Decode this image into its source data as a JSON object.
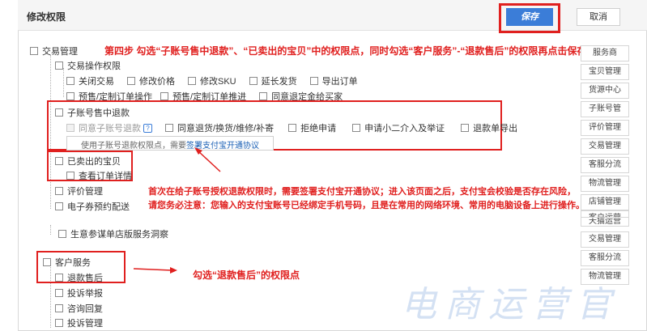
{
  "header": {
    "title": "修改权限",
    "save_label": "保存",
    "cancel_label": "取消"
  },
  "tree": {
    "trade": "交易管理",
    "trade_ops": "交易操作权限",
    "trade_ops_items": [
      "关闭交易",
      "修改价格",
      "修改SKU",
      "延长发货",
      "导出订单"
    ],
    "trade_ops_items2": [
      "预售/定制订单操作",
      "预售/定制订单推进",
      "同意退定金给买家"
    ],
    "refund": "子账号售中退款",
    "refund_items": [
      "同意子账号退款",
      "同意退货/换货/维修/补寄",
      "拒绝申请",
      "申请小二介入及举证",
      "退款单导出"
    ],
    "refund_hint": "使用子账号退款权限点，需要",
    "refund_hint_link": "签署支付宝开通协议",
    "sold": "已卖出的宝贝",
    "sold_items": [
      "查看订单详情"
    ],
    "review": "评价管理",
    "voucher": "电子券预约配送",
    "biz": "生意参谋单店版服务洞察",
    "cs": "客户服务",
    "cs_items": [
      "退款售后",
      "投诉举报",
      "咨询回复",
      "投诉管理"
    ]
  },
  "annotations": {
    "step4": "第四步   勾选“子账号售中退款”、“已卖出的宝贝”中的权限点，同时勾选“客户服务”-“退款售后”的权限再点击保存",
    "note_line1": "首次在给子账号授权退款权限时，需要签署支付宝开通协议；进入该页面之后，支付宝会校验是否存在风险，",
    "note_line2": "请您务必注意：您输入的支付宝账号已经绑定手机号码，且是在常用的网络环境、常用的电脑设备上进行操作。",
    "cs_note": "勾选“退款售后”的权限点"
  },
  "side_menu": [
    "服务商",
    "宝贝管理",
    "货源中心",
    "子账号管",
    "评价管理",
    "交易管理",
    "客服分流",
    "物流管理",
    "店铺管理",
    "客户运营",
    "天猫运营",
    "交易管理",
    "客服分流",
    "物流管理"
  ],
  "watermark": "电商运营官",
  "colors": {
    "accent": "#3b7dd8",
    "annotation": "#e0201f"
  }
}
